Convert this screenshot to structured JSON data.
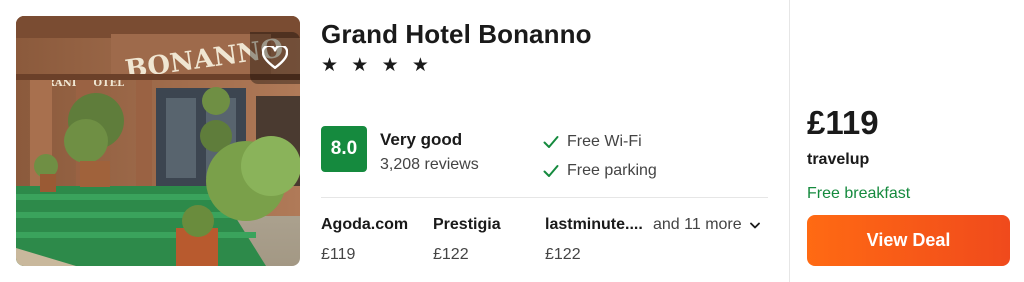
{
  "hotel": {
    "name": "Grand Hotel Bonanno",
    "stars_text": "★ ★ ★ ★",
    "star_count": 4,
    "photo_sign_text": "BONANNO",
    "photo_small_sign_text": "GRAND HOTEL"
  },
  "rating": {
    "score": "8.0",
    "label": "Very good",
    "reviews": "3,208 reviews",
    "badge_color": "#158a3e"
  },
  "amenities": [
    {
      "label": "Free Wi-Fi",
      "icon": "check-icon"
    },
    {
      "label": "Free parking",
      "icon": "check-icon"
    }
  ],
  "providers": [
    {
      "name": "Agoda.com",
      "price": "£119"
    },
    {
      "name": "Prestigia",
      "price": "£122"
    },
    {
      "name": "lastminute....",
      "price": "£122"
    }
  ],
  "more_providers": {
    "label": "and 11 more",
    "icon": "chevron-down-icon"
  },
  "deal": {
    "price": "£119",
    "provider": "travelup",
    "perk": "Free breakfast",
    "button_label": "View Deal",
    "button_color": "#f5541a",
    "perk_color": "#158a3e"
  },
  "icons": {
    "favorite": "heart-icon"
  }
}
